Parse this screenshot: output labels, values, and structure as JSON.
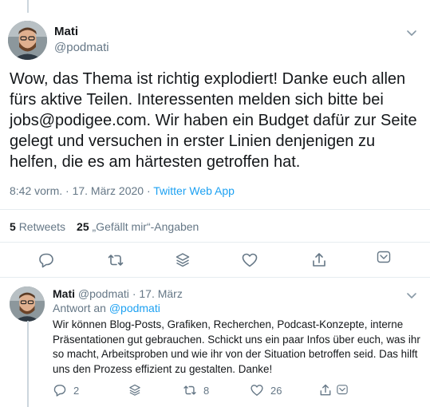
{
  "main_tweet": {
    "author_name": "Mati",
    "author_handle": "@podmati",
    "text": "Wow, das Thema ist richtig explodiert! Danke euch allen fürs aktive Teilen. Interessenten melden sich bitte bei jobs@podigee.com. Wir haben ein Budget dafür zur Seite gelegt und versuchen in erster Linien denjenigen zu helfen, die es am härtesten getroffen hat.",
    "timestamp": "8:42 vorm. · 17. März 2020",
    "separator": " · ",
    "source": "Twitter Web App",
    "retweets_count": "5",
    "retweets_label": "Retweets",
    "likes_count": "25",
    "likes_label": "„Gefällt mir“-Angaben",
    "actions": [
      "reply-icon",
      "retweet-icon",
      "share-stack-icon",
      "like-icon",
      "share-icon",
      "analytics-icon"
    ]
  },
  "reply_tweet": {
    "author_name": "Mati",
    "author_handle": "@podmati",
    "dot": "·",
    "date": "17. März",
    "reply_to_label": "Antwort an",
    "reply_to_handle": "@podmati",
    "text": "Wir können Blog-Posts, Grafiken, Recherchen, Podcast-Konzepte, interne Präsentationen gut gebrauchen. Schickt uns ein paar Infos über euch, was ihr so macht, Arbeitsproben und wie ihr von der Situation betroffen seid. Das hilft uns den Prozess effizient zu gestalten. Danke!",
    "reply_count": "2",
    "retweet_count": "8",
    "like_count": "26"
  },
  "colors": {
    "text": "#14171a",
    "secondary": "#657786",
    "accent": "#1da1f2",
    "divider": "#e6ecf0"
  }
}
